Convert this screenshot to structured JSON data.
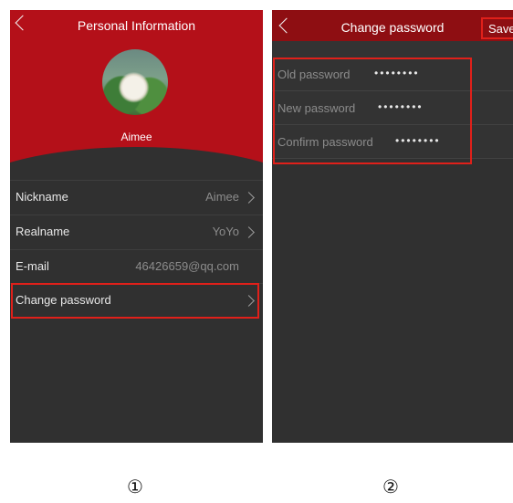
{
  "screen1": {
    "title": "Personal Information",
    "user_name": "Aimee",
    "rows": [
      {
        "label": "Nickname",
        "value": "Aimee"
      },
      {
        "label": "Realname",
        "value": "YoYo"
      },
      {
        "label": "E-mail",
        "value": "46426659@qq.com"
      },
      {
        "label": "Change password",
        "value": ""
      }
    ],
    "caption": "①"
  },
  "screen2": {
    "title": "Change password",
    "save_label": "Save",
    "fields": [
      {
        "label": "Old password",
        "value": "••••••••"
      },
      {
        "label": "New password",
        "value": "••••••••"
      },
      {
        "label": "Confirm password",
        "value": "••••••••"
      }
    ],
    "caption": "②"
  },
  "colors": {
    "header_red": "#b41019",
    "highlight_red": "#e0201a",
    "background_dark": "#303030"
  },
  "icons": [
    "back-chevron-icon",
    "chevron-right-icon"
  ]
}
